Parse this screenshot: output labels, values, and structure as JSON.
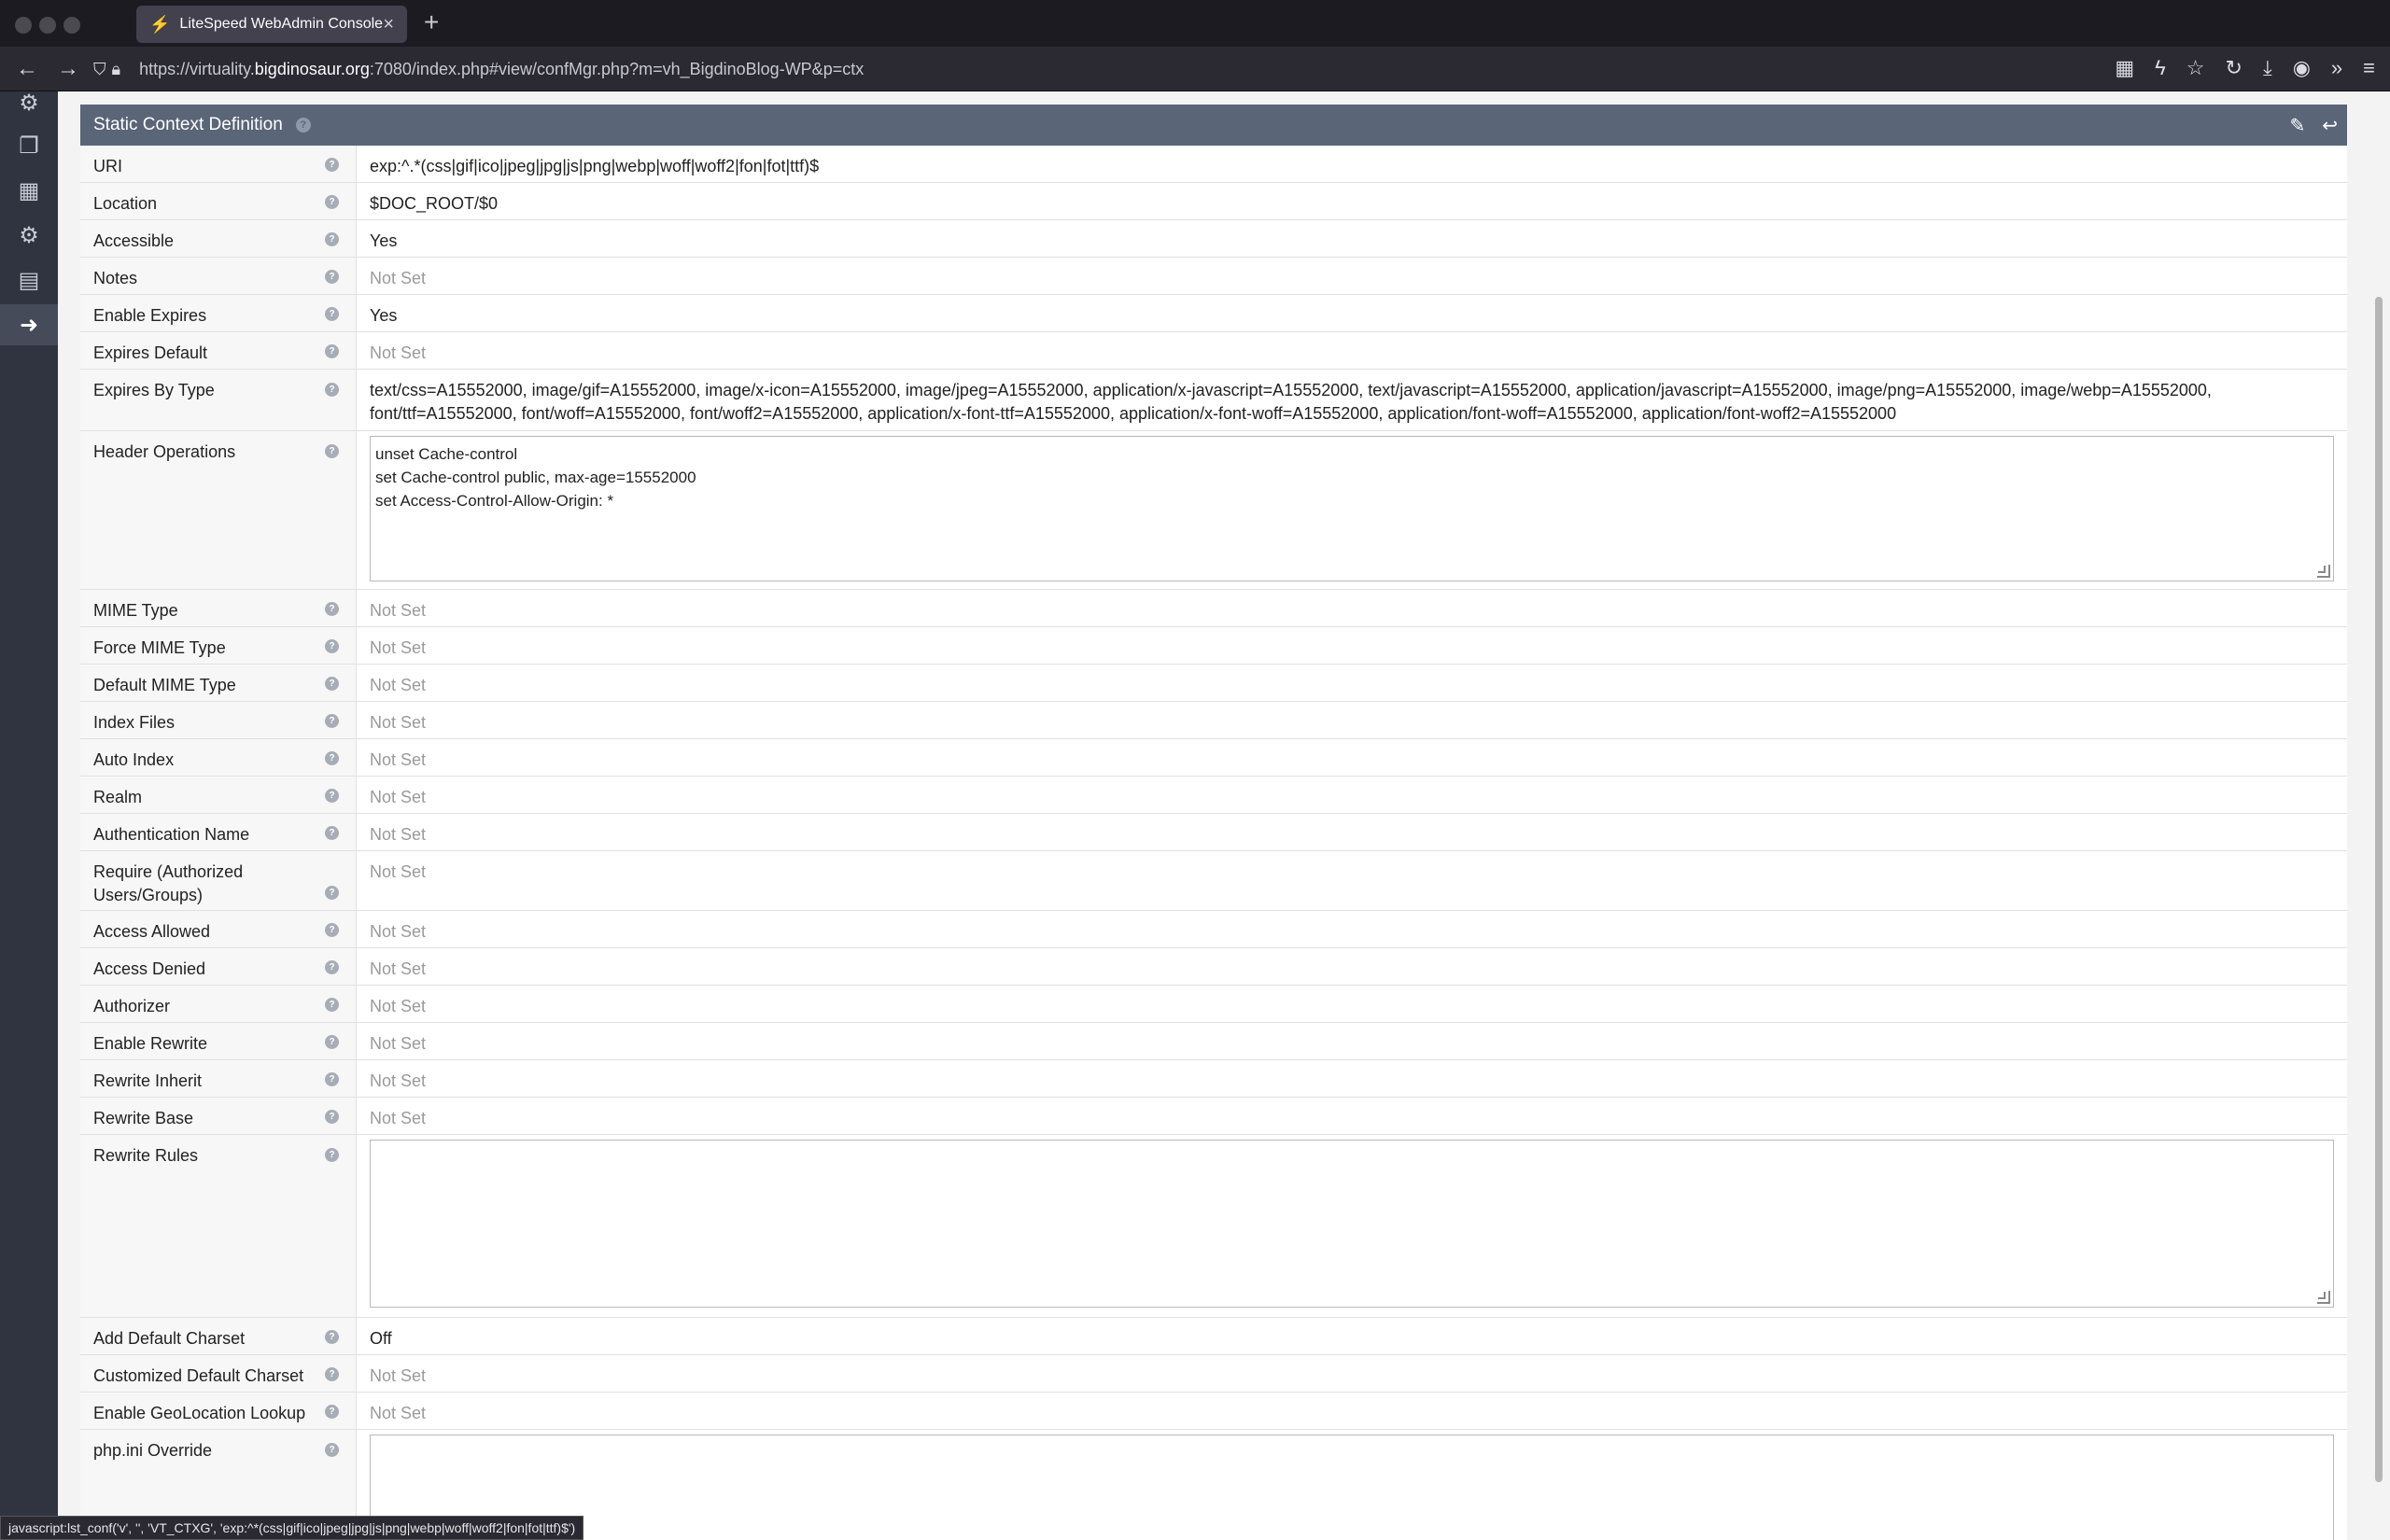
{
  "browser": {
    "tab_title": "LiteSpeed WebAdmin Console",
    "new_tab": "+",
    "url_prefix": "https://virtuality.",
    "url_host": "bigdinosaur.org",
    "url_suffix": ":7080/index.php#view/confMgr.php?m=vh_BigdinoBlog-WP&p=ctx"
  },
  "panel": {
    "title": "Static Context Definition"
  },
  "rows": [
    {
      "label": "URI",
      "value": "exp:^.*(css|gif|ico|jpeg|jpg|js|png|webp|woff|woff2|fon|fot|ttf)$"
    },
    {
      "label": "Location",
      "value": "$DOC_ROOT/$0"
    },
    {
      "label": "Accessible",
      "value": "Yes"
    },
    {
      "label": "Notes",
      "value": "Not Set"
    },
    {
      "label": "Enable Expires",
      "value": "Yes"
    },
    {
      "label": "Expires Default",
      "value": "Not Set"
    },
    {
      "label": "Expires By Type",
      "value": "text/css=A15552000, image/gif=A15552000, image/x-icon=A15552000, image/jpeg=A15552000, application/x-javascript=A15552000, text/javascript=A15552000, application/javascript=A15552000, image/png=A15552000, image/webp=A15552000, font/ttf=A15552000, font/woff=A15552000, font/woff2=A15552000, application/x-font-ttf=A15552000, application/x-font-woff=A15552000, application/font-woff=A15552000, application/font-woff2=A15552000"
    },
    {
      "label": "Header Operations",
      "value": "unset Cache-control\nset Cache-control public, max-age=15552000\nset Access-Control-Allow-Origin: *"
    },
    {
      "label": "MIME Type",
      "value": "Not Set"
    },
    {
      "label": "Force MIME Type",
      "value": "Not Set"
    },
    {
      "label": "Default MIME Type",
      "value": "Not Set"
    },
    {
      "label": "Index Files",
      "value": "Not Set"
    },
    {
      "label": "Auto Index",
      "value": "Not Set"
    },
    {
      "label": "Realm",
      "value": "Not Set"
    },
    {
      "label": "Authentication Name",
      "value": "Not Set"
    },
    {
      "label": "Require (Authorized Users/Groups)",
      "value": "Not Set"
    },
    {
      "label": "Access Allowed",
      "value": "Not Set"
    },
    {
      "label": "Access Denied",
      "value": "Not Set"
    },
    {
      "label": "Authorizer",
      "value": "Not Set"
    },
    {
      "label": "Enable Rewrite",
      "value": "Not Set"
    },
    {
      "label": "Rewrite Inherit",
      "value": "Not Set"
    },
    {
      "label": "Rewrite Base",
      "value": "Not Set"
    },
    {
      "label": "Rewrite Rules",
      "value": ""
    },
    {
      "label": "Add Default Charset",
      "value": "Off"
    },
    {
      "label": "Customized Default Charset",
      "value": "Not Set"
    },
    {
      "label": "Enable GeoLocation Lookup",
      "value": "Not Set"
    },
    {
      "label": "php.ini Override",
      "value": ""
    }
  ],
  "status_text": "javascript:lst_conf('v', '', 'VT_CTXG', 'exp:^*(css|gif|ico|jpeg|jpg|js|png|webp|woff|woff2|fon|fot|ttf)$')"
}
